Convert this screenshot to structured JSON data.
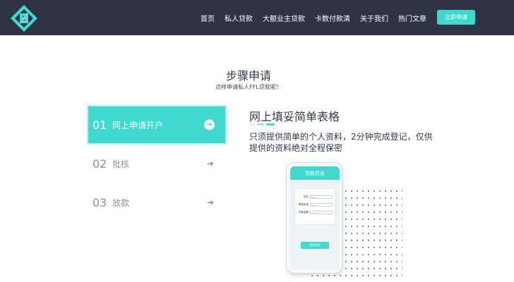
{
  "nav": {
    "items": [
      "首页",
      "私人贷款",
      "大额业主贷款",
      "卡数付款清",
      "关于我们",
      "热门文章"
    ],
    "apply_button": "立即申请"
  },
  "section": {
    "title": "步骤申请",
    "subtitle": "点样申请私人FFL贷款呢？"
  },
  "steps": [
    {
      "number": "01",
      "label": "网上申请开户",
      "active": true
    },
    {
      "number": "02",
      "label": "批核",
      "active": false
    },
    {
      "number": "03",
      "label": "放款",
      "active": false
    }
  ],
  "content": {
    "title": "网上填妥简单表格",
    "description": "只须提供简单的个人资料，2分钟完成登记，仅供提供的资料绝对全程保密"
  },
  "phone": {
    "header": "贷款信息",
    "fields": [
      {
        "label": "姓名",
        "placeholder": "Name"
      },
      {
        "label": "联络电话",
        "placeholder": "Phone"
      },
      {
        "label": "贷款金额",
        "placeholder": "Amount"
      }
    ],
    "submit": "提交资料"
  },
  "colors": {
    "header_bg": "#2e3444",
    "accent": "#3fd9cf",
    "text_dark": "#2f3a4d",
    "text_muted": "#8d9296"
  }
}
